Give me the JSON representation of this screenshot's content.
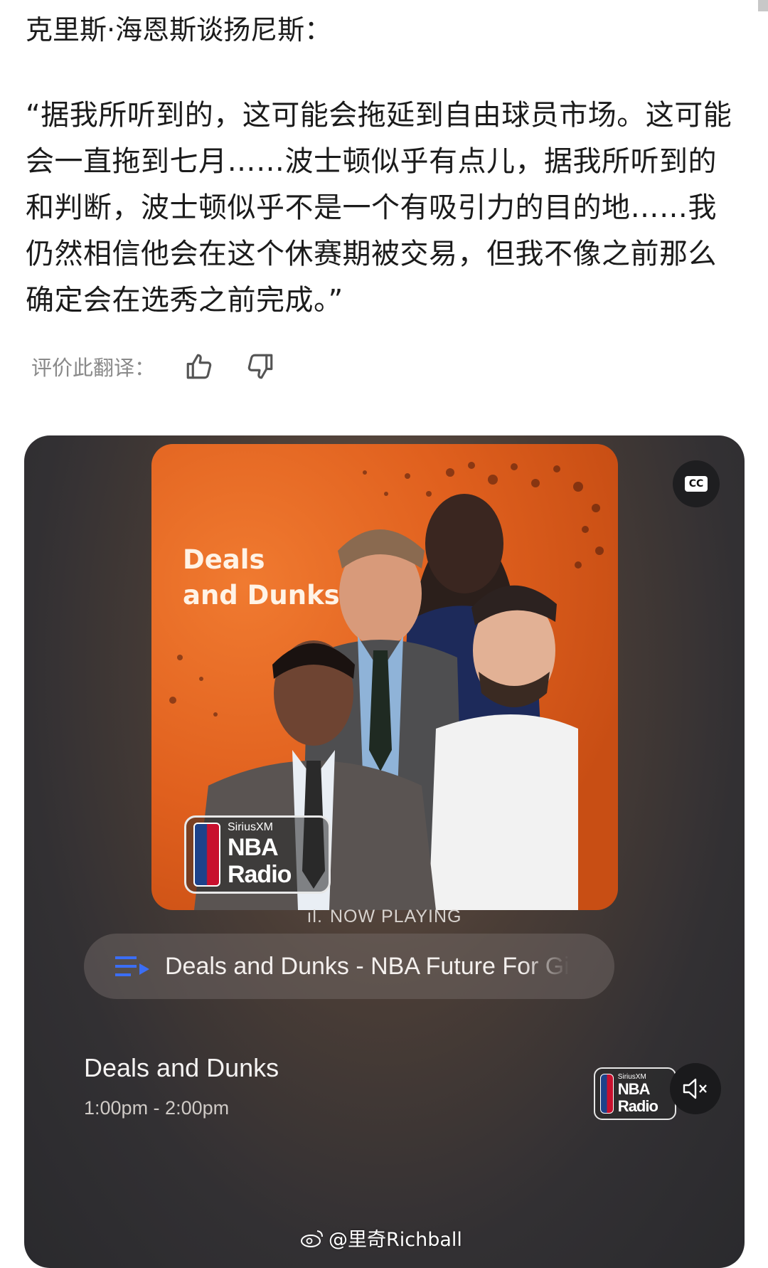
{
  "post": {
    "heading": "克里斯·海恩斯谈扬尼斯：",
    "quote": "“据我所听到的，这可能会拖延到自由球员市场。这可能会一直拖到七月……波士顿似乎有点儿，据我所听到的和判断，波士顿似乎不是一个有吸引力的目的地……我仍然相信他会在这个休赛期被交易，但我不像之前那么确定会在选秀之前完成。”",
    "rate_label": "评价此翻译：",
    "icons": {
      "like": "thumbs-up-icon",
      "dislike": "thumbs-down-icon"
    }
  },
  "player": {
    "art_title_line1": "Deals",
    "art_title_line2": "and Dunks",
    "logo_top": "SiriusXM",
    "logo_main": "NBA Radio",
    "cc_label": "CC",
    "now_playing_bars": "ıl.",
    "now_playing": "NOW PLAYING",
    "track_title": "Deals and Dunks - NBA Future For Gi",
    "show_name": "Deals and Dunks",
    "show_time": "1:00pm - 2:00pm",
    "colors": {
      "accent_blue": "#3b6ef5",
      "art_orange": "#e0601e"
    }
  },
  "watermark": {
    "text": "@里奇Richball",
    "icon": "weibo-icon"
  }
}
